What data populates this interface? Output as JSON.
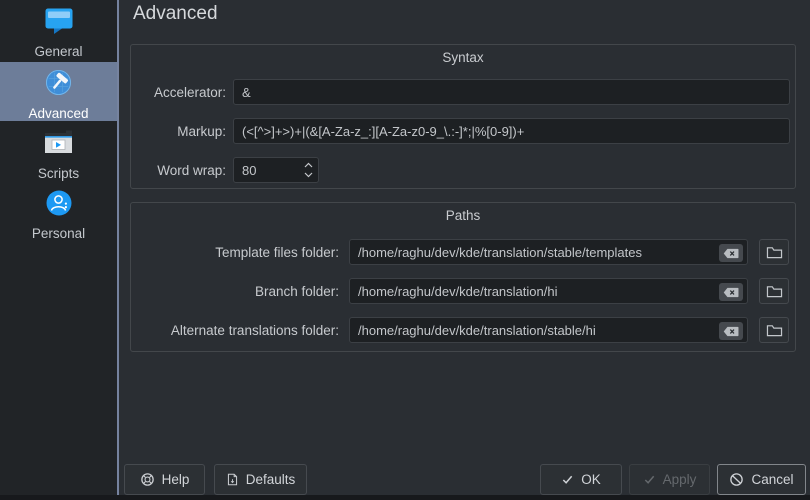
{
  "page": {
    "title": "Advanced"
  },
  "sidebar": {
    "items": [
      {
        "label": "General",
        "icon": "chat-bubble-icon",
        "selected": false
      },
      {
        "label": "Advanced",
        "icon": "hammer-icon",
        "selected": true
      },
      {
        "label": "Scripts",
        "icon": "script-window-icon",
        "selected": false
      },
      {
        "label": "Personal",
        "icon": "user-icon",
        "selected": false
      }
    ]
  },
  "syntax": {
    "title": "Syntax",
    "accelerator": {
      "label": "Accelerator:",
      "value": "&"
    },
    "markup": {
      "label": "Markup:",
      "value": "(<[^>]+>)+|(&[A-Za-z_:][A-Za-z0-9_\\.:-]*;|%[0-9])+"
    },
    "word_wrap": {
      "label": "Word wrap:",
      "value": "80"
    }
  },
  "paths": {
    "title": "Paths",
    "fields": [
      {
        "label": "Template files folder:",
        "value": "/home/raghu/dev/kde/translation/stable/templates"
      },
      {
        "label": "Branch folder:",
        "value": "/home/raghu/dev/kde/translation/hi"
      },
      {
        "label": "Alternate translations folder:",
        "value": "/home/raghu/dev/kde/translation/stable/hi"
      }
    ]
  },
  "buttons": {
    "help": "Help",
    "defaults": "Defaults",
    "ok": "OK",
    "apply": "Apply",
    "cancel": "Cancel"
  },
  "colors": {
    "accent_blue": "#1d99f3",
    "sidebar_selection": "#6d7d99"
  }
}
